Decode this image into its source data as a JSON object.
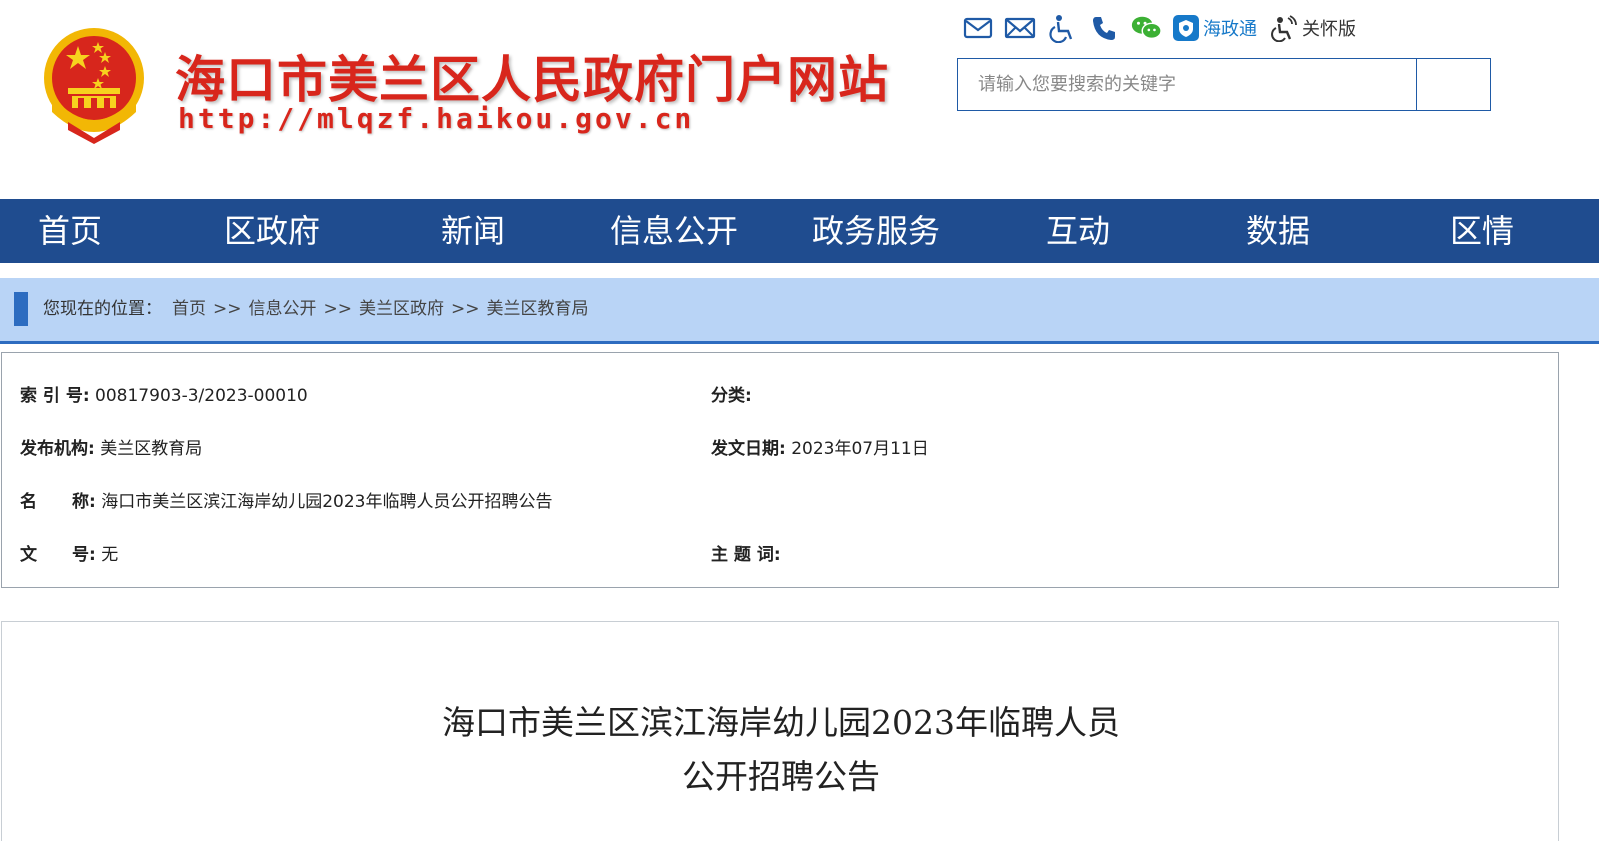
{
  "header": {
    "site_title": "海口市美兰区人民政府门户网站",
    "site_url": "http://mlqzf.haikou.gov.cn",
    "toolbar": {
      "haizhengtong_label": "海政通",
      "care_version_label": "关怀版"
    },
    "search": {
      "placeholder": "请输入您要搜索的关键字"
    }
  },
  "nav": {
    "items": [
      {
        "label": "首页"
      },
      {
        "label": "区政府"
      },
      {
        "label": "新闻"
      },
      {
        "label": "信息公开"
      },
      {
        "label": "政务服务"
      },
      {
        "label": "互动"
      },
      {
        "label": "数据"
      },
      {
        "label": "区情"
      }
    ]
  },
  "breadcrumb": {
    "prefix": "您现在的位置：",
    "separator": ">>",
    "items": [
      "首页",
      "信息公开",
      "美兰区政府",
      "美兰区教育局"
    ]
  },
  "meta": {
    "index_label": "索 引 号:",
    "index_value": "00817903-3/2023-00010",
    "category_label": "分类:",
    "category_value": "",
    "publisher_label": "发布机构:",
    "publisher_value": "美兰区教育局",
    "date_label": "发文日期:",
    "date_value": "2023年07月11日",
    "name_label_a": "名",
    "name_label_b": "称:",
    "name_value": "海口市美兰区滨江海岸幼儿园2023年临聘人员公开招聘公告",
    "docno_label_a": "文",
    "docno_label_b": "号:",
    "docno_value": "无",
    "keywords_label": "主 题 词:",
    "keywords_value": ""
  },
  "article": {
    "title_line1": "海口市美兰区滨江海岸幼儿园2023年临聘人员",
    "title_line2": "公开招聘公告"
  },
  "colors": {
    "nav_bg": "#1f4c8f",
    "title_red": "#d8261c",
    "crumb_bg": "#b9d4f6",
    "accent_blue": "#2d6cc0"
  }
}
